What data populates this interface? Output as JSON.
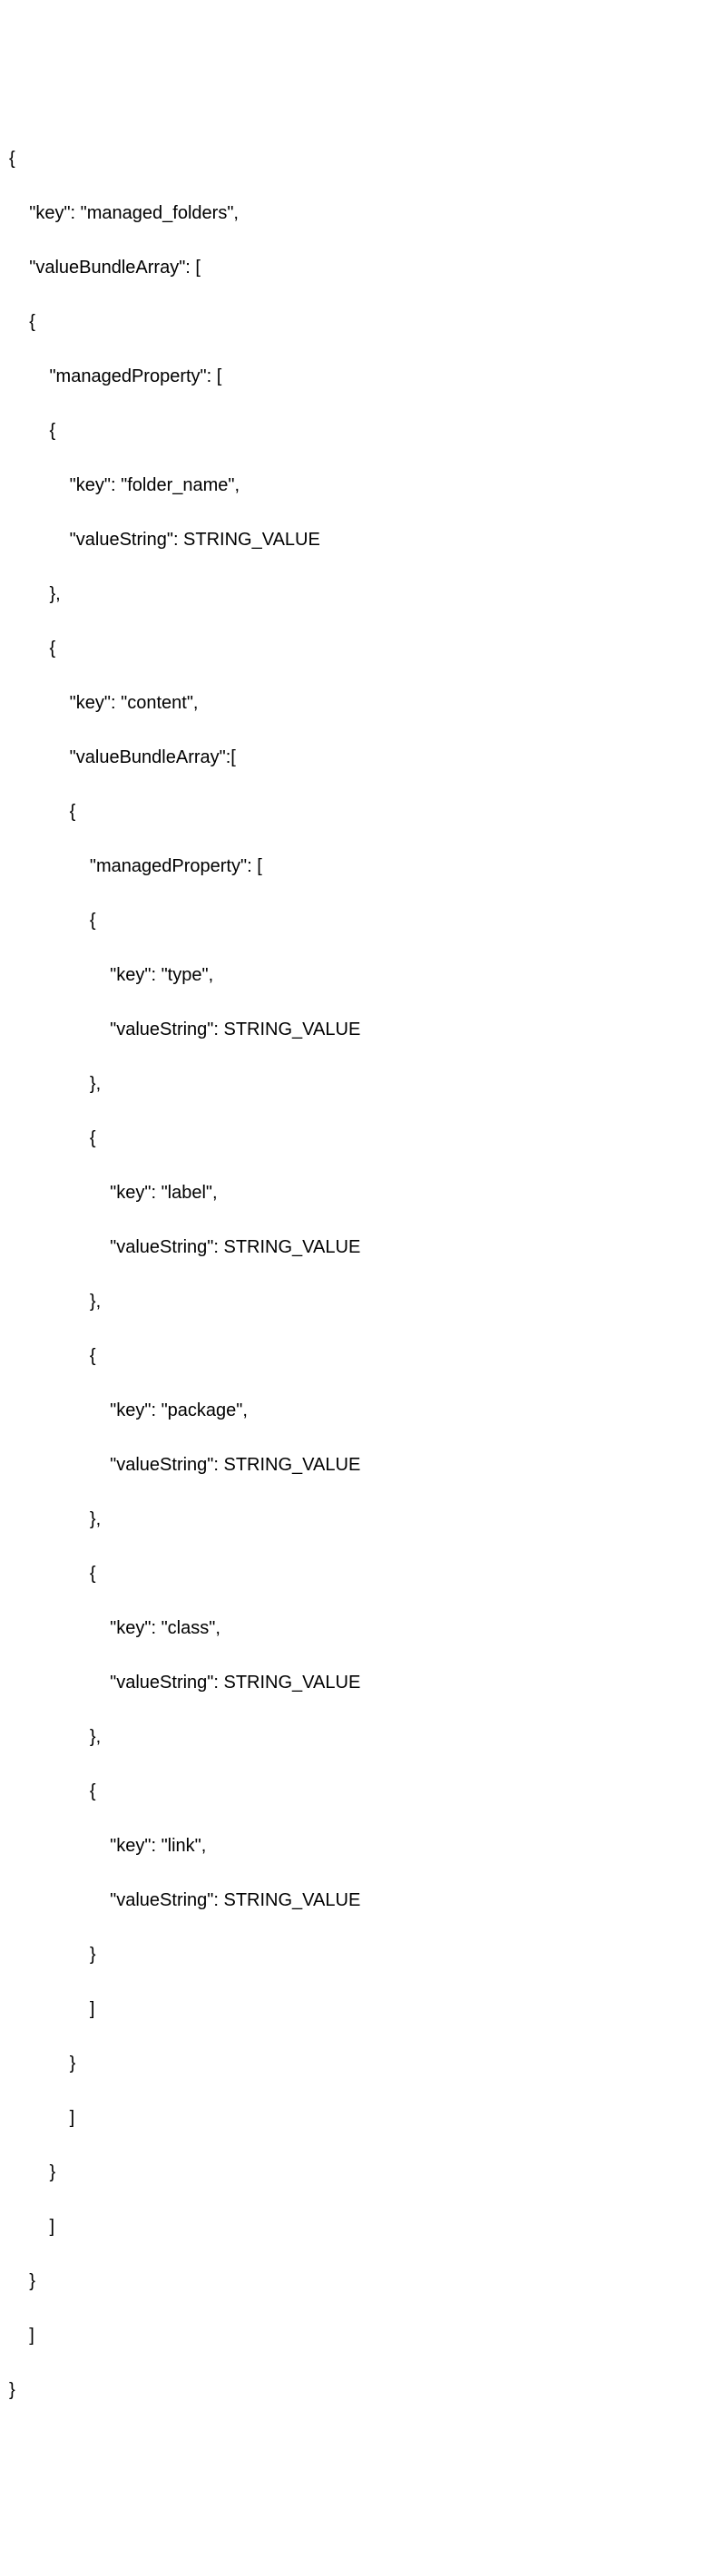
{
  "code": {
    "l01": "{",
    "l02": "    \"key\": \"managed_folders\",",
    "l03": "    \"valueBundleArray\": [",
    "l04": "    {",
    "l05": "        \"managedProperty\": [",
    "l06": "        {",
    "l07": "            \"key\": \"folder_name\",",
    "l08": "            \"valueString\": STRING_VALUE",
    "l09": "        },",
    "l10": "        {",
    "l11": "            \"key\": \"content\",",
    "l12": "            \"valueBundleArray\":[",
    "l13": "            {",
    "l14": "                \"managedProperty\": [",
    "l15": "                {",
    "l16": "                    \"key\": \"type\",",
    "l17": "                    \"valueString\": STRING_VALUE",
    "l18": "                },",
    "l19": "                {",
    "l20": "                    \"key\": \"label\",",
    "l21": "                    \"valueString\": STRING_VALUE",
    "l22": "                },",
    "l23": "                {",
    "l24": "                    \"key\": \"package\",",
    "l25": "                    \"valueString\": STRING_VALUE",
    "l26": "                },",
    "l27": "                {",
    "l28": "                    \"key\": \"class\",",
    "l29": "                    \"valueString\": STRING_VALUE",
    "l30": "                },",
    "l31": "                {",
    "l32": "                    \"key\": \"link\",",
    "l33": "                    \"valueString\": STRING_VALUE",
    "l34": "                }",
    "l35": "                ]",
    "l36": "            }",
    "l37": "            ]",
    "l38": "        }",
    "l39": "        ]",
    "l40": "    }",
    "l41": "    ]",
    "l42": "}"
  }
}
